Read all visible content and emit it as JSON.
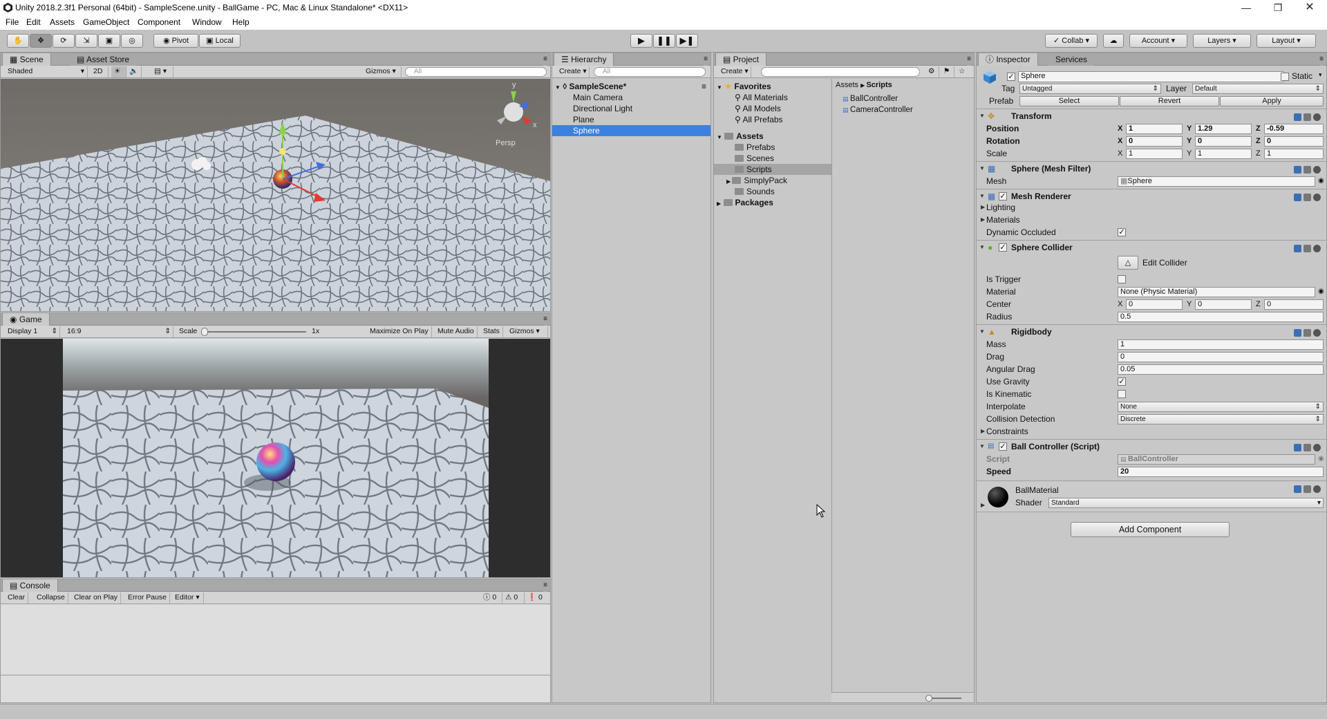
{
  "window": {
    "title": "Unity 2018.2.3f1 Personal (64bit) - SampleScene.unity - BallGame - PC, Mac & Linux Standalone* <DX11>"
  },
  "menu": [
    "File",
    "Edit",
    "Assets",
    "GameObject",
    "Component",
    "Window",
    "Help"
  ],
  "toolbar": {
    "pivot": "Pivot",
    "local": "Local",
    "collab": "Collab",
    "account": "Account",
    "layers": "Layers",
    "layout": "Layout"
  },
  "scene_panel": {
    "tab_scene": "Scene",
    "tab_asset_store": "Asset Store",
    "shading": "Shaded",
    "mode_2d": "2D",
    "gizmos": "Gizmos",
    "search_placeholder": "All",
    "persp": "Persp",
    "gizmo_axes": {
      "x": "x",
      "y": "y"
    }
  },
  "game_panel": {
    "tab": "Game",
    "display": "Display 1",
    "aspect": "16:9",
    "scale_label": "Scale",
    "scale_value": "1x",
    "maximize": "Maximize On Play",
    "mute": "Mute Audio",
    "stats": "Stats",
    "gizmos": "Gizmos"
  },
  "console_panel": {
    "tab": "Console",
    "clear": "Clear",
    "collapse": "Collapse",
    "clear_on_play": "Clear on Play",
    "error_pause": "Error Pause",
    "editor": "Editor",
    "count_info": "0",
    "count_warn": "0",
    "count_error": "0"
  },
  "hierarchy": {
    "tab": "Hierarchy",
    "create": "Create",
    "search_placeholder": "All",
    "scene": "SampleScene*",
    "items": [
      "Main Camera",
      "Directional Light",
      "Plane",
      "Sphere"
    ],
    "selected": "Sphere"
  },
  "project": {
    "tab": "Project",
    "create": "Create",
    "favorites": "Favorites",
    "favorite_items": [
      "All Materials",
      "All Models",
      "All Prefabs"
    ],
    "assets": "Assets",
    "asset_folders": [
      "Prefabs",
      "Scenes",
      "Scripts",
      "SimplyPack",
      "Sounds"
    ],
    "selected_folder": "Scripts",
    "packages": "Packages",
    "breadcrumb": [
      "Assets",
      "Scripts"
    ],
    "files": [
      "BallController",
      "CameraController"
    ]
  },
  "inspector": {
    "tab_inspector": "Inspector",
    "tab_services": "Services",
    "object_name": "Sphere",
    "static_label": "Static",
    "tag_label": "Tag",
    "tag_value": "Untagged",
    "layer_label": "Layer",
    "layer_value": "Default",
    "prefab_label": "Prefab",
    "prefab_select": "Select",
    "prefab_revert": "Revert",
    "prefab_apply": "Apply",
    "transform": {
      "title": "Transform",
      "position_label": "Position",
      "rotation_label": "Rotation",
      "scale_label": "Scale",
      "axis_x": "X",
      "axis_y": "Y",
      "axis_z": "Z",
      "position": [
        "1",
        "1.29",
        "-0.59"
      ],
      "rotation": [
        "0",
        "0",
        "0"
      ],
      "scale": [
        "1",
        "1",
        "1"
      ]
    },
    "mesh_filter": {
      "title": "Sphere (Mesh Filter)",
      "mesh_label": "Mesh",
      "mesh_value": "Sphere"
    },
    "mesh_renderer": {
      "title": "Mesh Renderer",
      "lighting": "Lighting",
      "materials": "Materials",
      "dynamic_occluded": "Dynamic Occluded"
    },
    "sphere_collider": {
      "title": "Sphere Collider",
      "edit_collider": "Edit Collider",
      "is_trigger": "Is Trigger",
      "material_label": "Material",
      "material_value": "None (Physic Material)",
      "center_label": "Center",
      "center": [
        "0",
        "0",
        "0"
      ],
      "radius_label": "Radius",
      "radius": "0.5"
    },
    "rigidbody": {
      "title": "Rigidbody",
      "mass_label": "Mass",
      "mass": "1",
      "drag_label": "Drag",
      "drag": "0",
      "angular_drag_label": "Angular Drag",
      "angular_drag": "0.05",
      "use_gravity": "Use Gravity",
      "is_kinematic": "Is Kinematic",
      "interpolate_label": "Interpolate",
      "interpolate": "None",
      "collision_label": "Collision Detection",
      "collision": "Discrete",
      "constraints": "Constraints"
    },
    "ball_controller": {
      "title": "Ball Controller (Script)",
      "script_label": "Script",
      "script_value": "BallController",
      "speed_label": "Speed",
      "speed": "20"
    },
    "material": {
      "name": "BallMaterial",
      "shader_label": "Shader",
      "shader_value": "Standard"
    },
    "add_component": "Add Component"
  }
}
